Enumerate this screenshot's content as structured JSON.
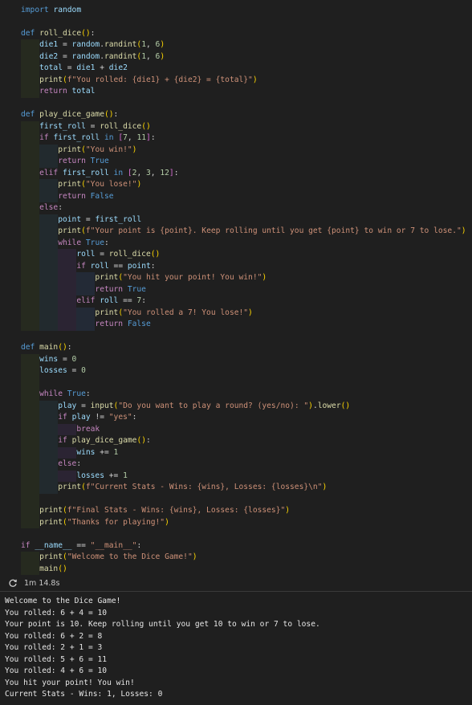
{
  "editor": {
    "lines": [
      "import random",
      "",
      "def roll_dice():",
      "    die1 = random.randint(1, 6)",
      "    die2 = random.randint(1, 6)",
      "    total = die1 + die2",
      "    print(f\"You rolled: {die1} + {die2} = {total}\")",
      "    return total",
      "",
      "def play_dice_game():",
      "    first_roll = roll_dice()",
      "    if first_roll in [7, 11]:",
      "        print(\"You win!\")",
      "        return True",
      "    elif first_roll in [2, 3, 12]:",
      "        print(\"You lose!\")",
      "        return False",
      "    else:",
      "        point = first_roll",
      "        print(f\"Your point is {point}. Keep rolling until you get {point} to win or 7 to lose.\")",
      "        while True:",
      "            roll = roll_dice()",
      "            if roll == point:",
      "                print(\"You hit your point! You win!\")",
      "                return True",
      "            elif roll == 7:",
      "                print(\"You rolled a 7! You lose!\")",
      "                return False",
      "",
      "def main():",
      "    wins = 0",
      "    losses = 0",
      "",
      "    while True:",
      "        play = input(\"Do you want to play a round? (yes/no): \").lower()",
      "        if play != \"yes\":",
      "            break",
      "        if play_dice_game():",
      "            wins += 1",
      "        else:",
      "            losses += 1",
      "        print(f\"Current Stats - Wins: {wins}, Losses: {losses}\\n\")",
      "",
      "    print(f\"Final Stats - Wins: {wins}, Losses: {losses}\")",
      "    print(\"Thanks for playing!\")",
      "",
      "if __name__ == \"__main__\":",
      "    print(\"Welcome to the Dice Game!\")",
      "    main()"
    ]
  },
  "execution": {
    "icon": "refresh-icon",
    "time": "1m 14.8s"
  },
  "output": {
    "lines": [
      "Welcome to the Dice Game!",
      "You rolled: 6 + 4 = 10",
      "Your point is 10. Keep rolling until you get 10 to win or 7 to lose.",
      "You rolled: 6 + 2 = 8",
      "You rolled: 2 + 1 = 3",
      "You rolled: 5 + 6 = 11",
      "You rolled: 4 + 6 = 10",
      "You hit your point! You win!",
      "Current Stats - Wins: 1, Losses: 0"
    ]
  },
  "colors": {
    "background": "#1f1f1f",
    "keyword": "#569cd6",
    "control": "#c586c0",
    "function": "#dcdcaa",
    "string": "#ce9178",
    "number": "#b5cea8"
  }
}
